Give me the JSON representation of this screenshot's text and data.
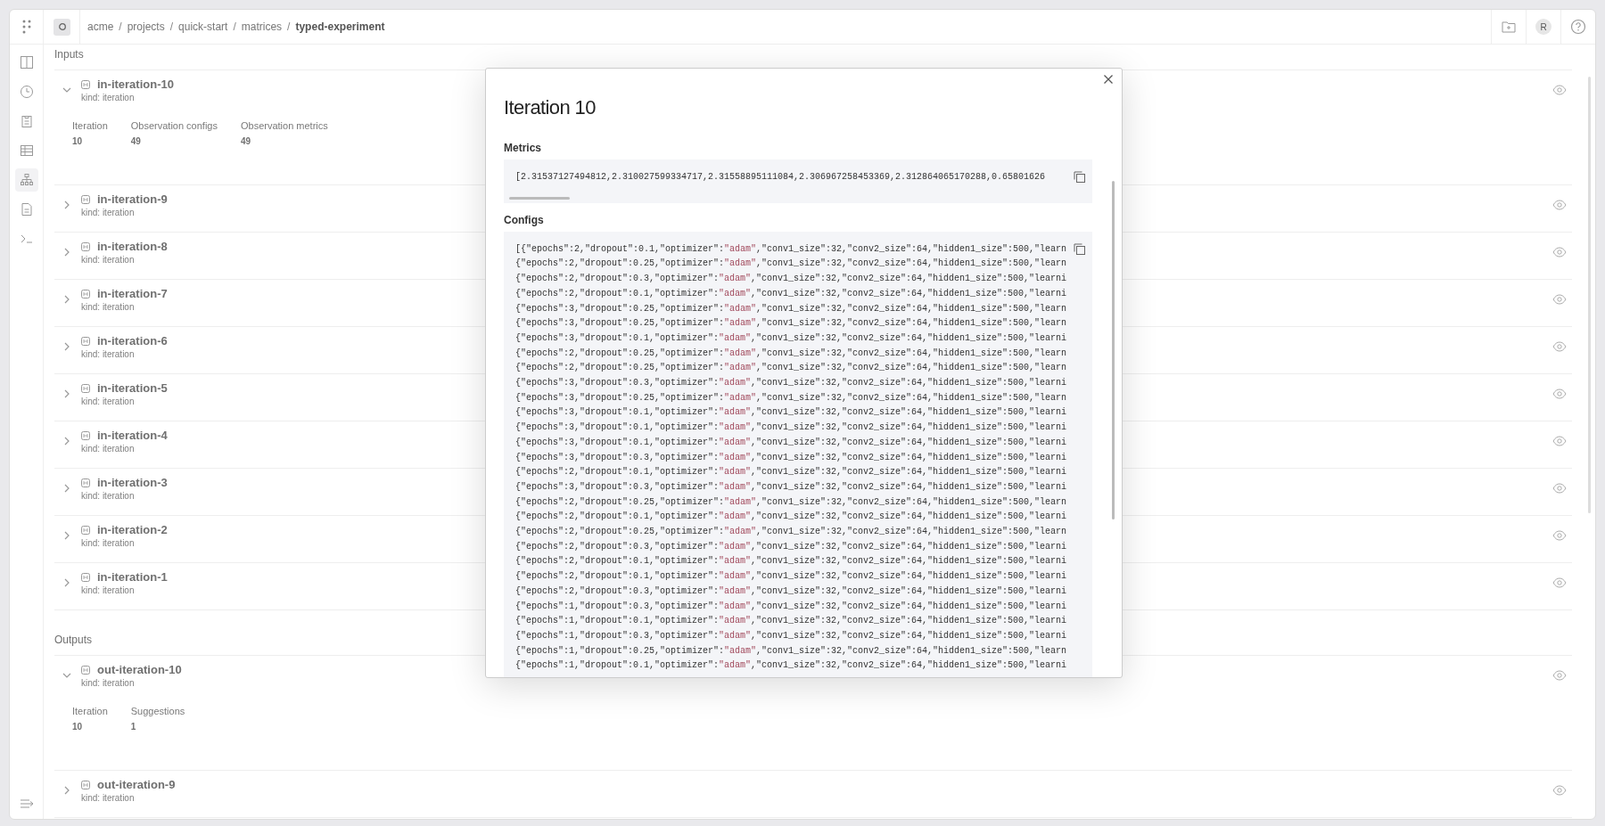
{
  "breadcrumbs": [
    "acme",
    "projects",
    "quick-start",
    "matrices",
    "typed-experiment"
  ],
  "breadcrumb_separator": "/",
  "avatar": {
    "initial": "R"
  },
  "inputs": {
    "title": "Inputs",
    "items": [
      {
        "name": "in-iteration-10",
        "subtitle": "kind: iteration",
        "expanded": true,
        "details": [
          {
            "label": "Iteration",
            "value": "10"
          },
          {
            "label": "Observation configs",
            "value": "49"
          },
          {
            "label": "Observation metrics",
            "value": "49"
          }
        ]
      },
      {
        "name": "in-iteration-9",
        "subtitle": "kind: iteration",
        "expanded": false
      },
      {
        "name": "in-iteration-8",
        "subtitle": "kind: iteration",
        "expanded": false
      },
      {
        "name": "in-iteration-7",
        "subtitle": "kind: iteration",
        "expanded": false
      },
      {
        "name": "in-iteration-6",
        "subtitle": "kind: iteration",
        "expanded": false
      },
      {
        "name": "in-iteration-5",
        "subtitle": "kind: iteration",
        "expanded": false
      },
      {
        "name": "in-iteration-4",
        "subtitle": "kind: iteration",
        "expanded": false
      },
      {
        "name": "in-iteration-3",
        "subtitle": "kind: iteration",
        "expanded": false
      },
      {
        "name": "in-iteration-2",
        "subtitle": "kind: iteration",
        "expanded": false
      },
      {
        "name": "in-iteration-1",
        "subtitle": "kind: iteration",
        "expanded": false
      }
    ]
  },
  "outputs": {
    "title": "Outputs",
    "items": [
      {
        "name": "out-iteration-10",
        "subtitle": "kind: iteration",
        "expanded": true,
        "details": [
          {
            "label": "Iteration",
            "value": "10"
          },
          {
            "label": "Suggestions",
            "value": "1"
          }
        ]
      },
      {
        "name": "out-iteration-9",
        "subtitle": "kind: iteration",
        "expanded": false
      }
    ]
  },
  "dialog": {
    "title": "Iteration 10",
    "sections": [
      {
        "label": "Metrics",
        "scrollbar": true,
        "lines": [
          "[2.31537127494812,2.310027599334717,2.31558895111084,2.306967258453369,2.312864065170288,0.65801626"
        ]
      },
      {
        "label": "Configs",
        "scrollbar": false,
        "lines": [
          "[{\"epochs\":2,\"dropout\":0.1,\"optimizer\":\"adam\",\"conv1_size\":32,\"conv2_size\":64,\"hidden1_size\":500,\"learn",
          "{\"epochs\":2,\"dropout\":0.25,\"optimizer\":\"adam\",\"conv1_size\":32,\"conv2_size\":64,\"hidden1_size\":500,\"learn",
          "{\"epochs\":2,\"dropout\":0.3,\"optimizer\":\"adam\",\"conv1_size\":32,\"conv2_size\":64,\"hidden1_size\":500,\"learni",
          "{\"epochs\":2,\"dropout\":0.1,\"optimizer\":\"adam\",\"conv1_size\":32,\"conv2_size\":64,\"hidden1_size\":500,\"learni",
          "{\"epochs\":3,\"dropout\":0.25,\"optimizer\":\"adam\",\"conv1_size\":32,\"conv2_size\":64,\"hidden1_size\":500,\"learn",
          "{\"epochs\":3,\"dropout\":0.25,\"optimizer\":\"adam\",\"conv1_size\":32,\"conv2_size\":64,\"hidden1_size\":500,\"learn",
          "{\"epochs\":3,\"dropout\":0.1,\"optimizer\":\"adam\",\"conv1_size\":32,\"conv2_size\":64,\"hidden1_size\":500,\"learni",
          "{\"epochs\":2,\"dropout\":0.25,\"optimizer\":\"adam\",\"conv1_size\":32,\"conv2_size\":64,\"hidden1_size\":500,\"learn",
          "{\"epochs\":2,\"dropout\":0.25,\"optimizer\":\"adam\",\"conv1_size\":32,\"conv2_size\":64,\"hidden1_size\":500,\"learn",
          "{\"epochs\":3,\"dropout\":0.3,\"optimizer\":\"adam\",\"conv1_size\":32,\"conv2_size\":64,\"hidden1_size\":500,\"learni",
          "{\"epochs\":3,\"dropout\":0.25,\"optimizer\":\"adam\",\"conv1_size\":32,\"conv2_size\":64,\"hidden1_size\":500,\"learn",
          "{\"epochs\":3,\"dropout\":0.1,\"optimizer\":\"adam\",\"conv1_size\":32,\"conv2_size\":64,\"hidden1_size\":500,\"learni",
          "{\"epochs\":3,\"dropout\":0.1,\"optimizer\":\"adam\",\"conv1_size\":32,\"conv2_size\":64,\"hidden1_size\":500,\"learni",
          "{\"epochs\":3,\"dropout\":0.1,\"optimizer\":\"adam\",\"conv1_size\":32,\"conv2_size\":64,\"hidden1_size\":500,\"learni",
          "{\"epochs\":3,\"dropout\":0.3,\"optimizer\":\"adam\",\"conv1_size\":32,\"conv2_size\":64,\"hidden1_size\":500,\"learni",
          "{\"epochs\":2,\"dropout\":0.1,\"optimizer\":\"adam\",\"conv1_size\":32,\"conv2_size\":64,\"hidden1_size\":500,\"learni",
          "{\"epochs\":3,\"dropout\":0.3,\"optimizer\":\"adam\",\"conv1_size\":32,\"conv2_size\":64,\"hidden1_size\":500,\"learni",
          "{\"epochs\":2,\"dropout\":0.25,\"optimizer\":\"adam\",\"conv1_size\":32,\"conv2_size\":64,\"hidden1_size\":500,\"learn",
          "{\"epochs\":2,\"dropout\":0.1,\"optimizer\":\"adam\",\"conv1_size\":32,\"conv2_size\":64,\"hidden1_size\":500,\"learni",
          "{\"epochs\":2,\"dropout\":0.25,\"optimizer\":\"adam\",\"conv1_size\":32,\"conv2_size\":64,\"hidden1_size\":500,\"learn",
          "{\"epochs\":2,\"dropout\":0.3,\"optimizer\":\"adam\",\"conv1_size\":32,\"conv2_size\":64,\"hidden1_size\":500,\"learni",
          "{\"epochs\":2,\"dropout\":0.1,\"optimizer\":\"adam\",\"conv1_size\":32,\"conv2_size\":64,\"hidden1_size\":500,\"learni",
          "{\"epochs\":2,\"dropout\":0.1,\"optimizer\":\"adam\",\"conv1_size\":32,\"conv2_size\":64,\"hidden1_size\":500,\"learni",
          "{\"epochs\":2,\"dropout\":0.3,\"optimizer\":\"adam\",\"conv1_size\":32,\"conv2_size\":64,\"hidden1_size\":500,\"learni",
          "{\"epochs\":1,\"dropout\":0.3,\"optimizer\":\"adam\",\"conv1_size\":32,\"conv2_size\":64,\"hidden1_size\":500,\"learni",
          "{\"epochs\":1,\"dropout\":0.1,\"optimizer\":\"adam\",\"conv1_size\":32,\"conv2_size\":64,\"hidden1_size\":500,\"learni",
          "{\"epochs\":1,\"dropout\":0.3,\"optimizer\":\"adam\",\"conv1_size\":32,\"conv2_size\":64,\"hidden1_size\":500,\"learni",
          "{\"epochs\":1,\"dropout\":0.25,\"optimizer\":\"adam\",\"conv1_size\":32,\"conv2_size\":64,\"hidden1_size\":500,\"learn",
          "{\"epochs\":1,\"dropout\":0.1,\"optimizer\":\"adam\",\"conv1_size\":32,\"conv2_size\":64,\"hidden1_size\":500,\"learni"
        ]
      }
    ]
  }
}
